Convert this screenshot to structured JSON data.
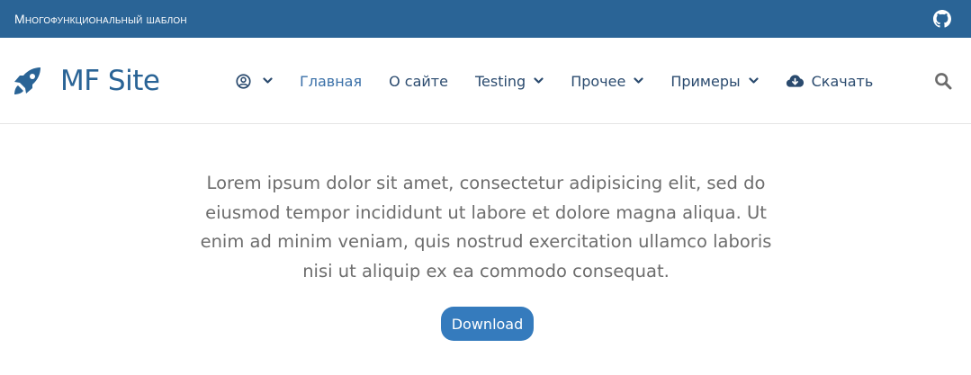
{
  "topbar": {
    "title": "Многофункциональный шаблон",
    "github_icon": "github-icon",
    "background": "#2a6496"
  },
  "brand": {
    "name": "MF Site",
    "icon": "rocket-icon",
    "color": "#2a6496"
  },
  "nav": {
    "user_icon": "user-circle-icon",
    "items": [
      {
        "label": "Главная",
        "active": true
      },
      {
        "label": "О сайте"
      },
      {
        "label": "Testing",
        "dropdown": true
      },
      {
        "label": "Прочее",
        "dropdown": true
      },
      {
        "label": "Примеры",
        "dropdown": true
      },
      {
        "label": "Скачать",
        "icon": "cloud-download-icon"
      }
    ],
    "search_icon": "search-icon"
  },
  "hero": {
    "text": "Lorem ipsum dolor sit amet, consectetur adipisicing elit, sed do eiusmod tempor incididunt ut labore et dolore magna aliqua. Ut enim ad minim veniam, quis nostrud exercitation ullamco laboris nisi ut aliquip ex ea commodo consequat.",
    "button_label": "Download",
    "button_color": "#357bbd"
  }
}
